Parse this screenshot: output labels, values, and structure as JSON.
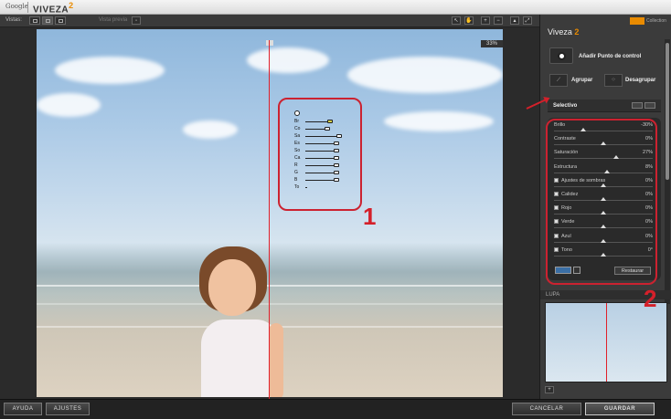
{
  "window": {
    "google_label": "Google",
    "app_name": "VIVEZA",
    "app_version": "2"
  },
  "toolbar": {
    "vistas_label": "Vistas:",
    "vista_previa_label": "Vista previa",
    "zoom_level": "33%"
  },
  "control_point": {
    "rows": [
      {
        "label": "Br",
        "value_ratio": 0.6
      },
      {
        "label": "Co",
        "value_ratio": 0.75
      },
      {
        "label": "Sa",
        "value_ratio": 0.85
      },
      {
        "label": "Es",
        "value_ratio": 0.78
      },
      {
        "label": "So",
        "value_ratio": 0.78
      },
      {
        "label": "Ca",
        "value_ratio": 0.78
      },
      {
        "label": "R",
        "value_ratio": 0.78
      },
      {
        "label": "G",
        "value_ratio": 0.78
      },
      {
        "label": "B",
        "value_ratio": 0.78
      },
      {
        "label": "To",
        "value_ratio": 0.0
      }
    ]
  },
  "annotations": {
    "one": "1",
    "two": "2"
  },
  "panel": {
    "brand": "Viveza",
    "brand_version": "2",
    "collection_label": "Collection",
    "add_control_point": "Añadir Punto de control",
    "group": "Agrupar",
    "ungroup": "Desagrupar",
    "selective": "Selectivo",
    "restore": "Restaurar",
    "lupa": "LUPA",
    "sliders": [
      {
        "label": "Brillo",
        "value": "-30%",
        "checkbox": false,
        "pos": 0.3
      },
      {
        "label": "Contraste",
        "value": "0%",
        "checkbox": false,
        "pos": 0.5
      },
      {
        "label": "Saturación",
        "value": "27%",
        "checkbox": false,
        "pos": 0.63
      },
      {
        "label": "Estructura",
        "value": "8%",
        "checkbox": false,
        "pos": 0.54
      },
      {
        "label": "Ajustes de sombras",
        "value": "0%",
        "checkbox": true,
        "pos": 0.5
      },
      {
        "label": "Calidez",
        "value": "0%",
        "checkbox": true,
        "pos": 0.5
      },
      {
        "label": "Rojo",
        "value": "0%",
        "checkbox": true,
        "pos": 0.5
      },
      {
        "label": "Verde",
        "value": "0%",
        "checkbox": true,
        "pos": 0.5
      },
      {
        "label": "Azul",
        "value": "0%",
        "checkbox": true,
        "pos": 0.5
      },
      {
        "label": "Tono",
        "value": "0°",
        "checkbox": true,
        "pos": 0.5
      }
    ]
  },
  "bottom": {
    "help": "AYUDA",
    "settings": "AJUSTES",
    "cancel": "CANCELAR",
    "save": "GUARDAR"
  },
  "colors": {
    "accent": "#e98b00",
    "annotation_red": "#cc2230"
  }
}
